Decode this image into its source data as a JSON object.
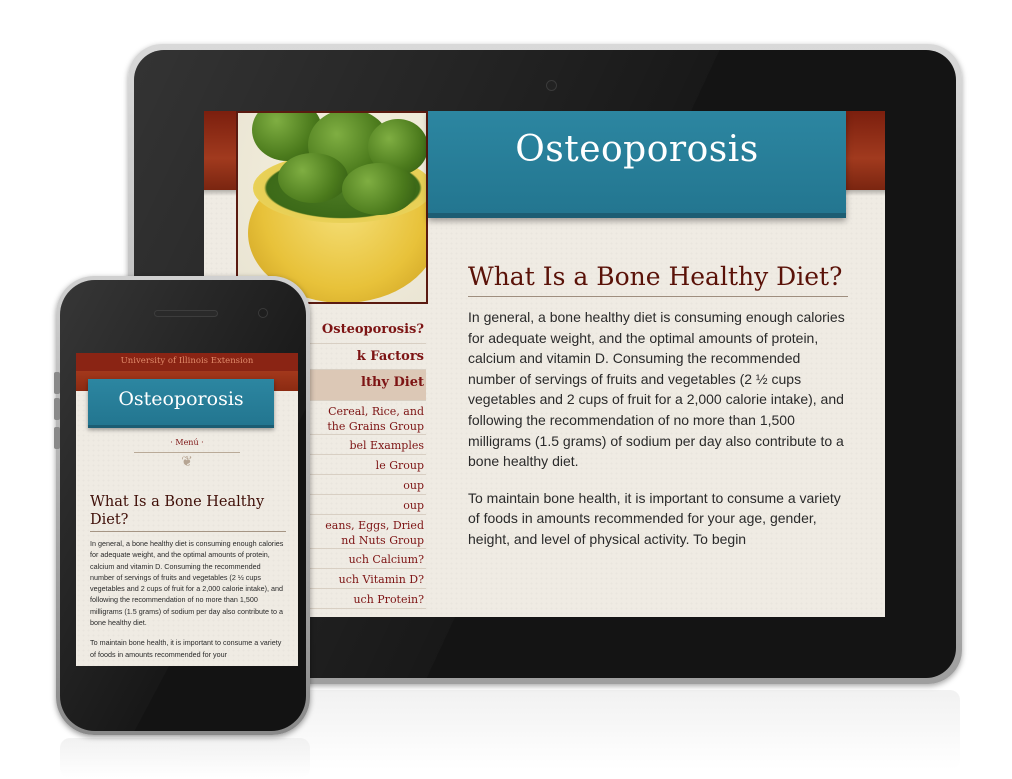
{
  "tablet": {
    "site_title": "Osteoporosis",
    "nav_items": [
      {
        "label": "Osteoporosis?",
        "level": "main"
      },
      {
        "label": "k Factors",
        "level": "main"
      },
      {
        "label": "lthy Diet",
        "level": "main",
        "active": true
      },
      {
        "label": "Cereal, Rice, and\nthe Grains Group",
        "level": "sub"
      },
      {
        "label": "bel Examples",
        "level": "sub"
      },
      {
        "label": "le Group",
        "level": "sub"
      },
      {
        "label": "oup",
        "level": "sub"
      },
      {
        "label": "oup",
        "level": "sub"
      },
      {
        "label": "eans, Eggs, Dried\nnd Nuts Group",
        "level": "sub"
      },
      {
        "label": "uch Calcium?",
        "level": "sub"
      },
      {
        "label": "uch Vitamin D?",
        "level": "sub"
      },
      {
        "label": "uch Protein?",
        "level": "sub"
      }
    ],
    "heading": "What Is a Bone Healthy Diet?",
    "paragraph1": "In general, a bone healthy diet is consuming enough calories for adequate weight, and the optimal amounts of protein, calcium and vitamin D. Consuming the recommended number of servings of fruits and vegetables (2 ½ cups vegetables and 2 cups of fruit for a 2,000 calorie intake), and following the recommendation of no more than 1,500 milligrams (1.5 grams) of sodium per day also contribute to a bone healthy diet.",
    "paragraph2": "To maintain bone health, it is important to consume a variety of foods in amounts recommended for your age, gender, height, and level of physical activity. To begin"
  },
  "phone": {
    "org_bar": "University of Illinois Extension",
    "site_title": "Osteoporosis",
    "menu_label": "· Menú ·",
    "heading": "What Is a Bone Healthy Diet?",
    "paragraph1": "In general, a bone healthy diet is consuming enough calories for adequate weight, and the optimal amounts of protein, calcium and vitamin D. Consuming the recommended number of servings of fruits and vegetables (2 ½ cups vegetables and 2 cups of fruit for a 2,000 calorie intake), and following the recommendation of no more than 1,500 milligrams (1.5 grams) of sodium per day also contribute to a bone healthy diet.",
    "paragraph2": "To maintain bone health, it is important to consume a variety of foods in amounts recommended for your"
  },
  "colors": {
    "title_blue": "#2c86a1",
    "header_red": "#a13a1e",
    "nav_text": "#7d1414",
    "heading_text": "#5a1208"
  }
}
